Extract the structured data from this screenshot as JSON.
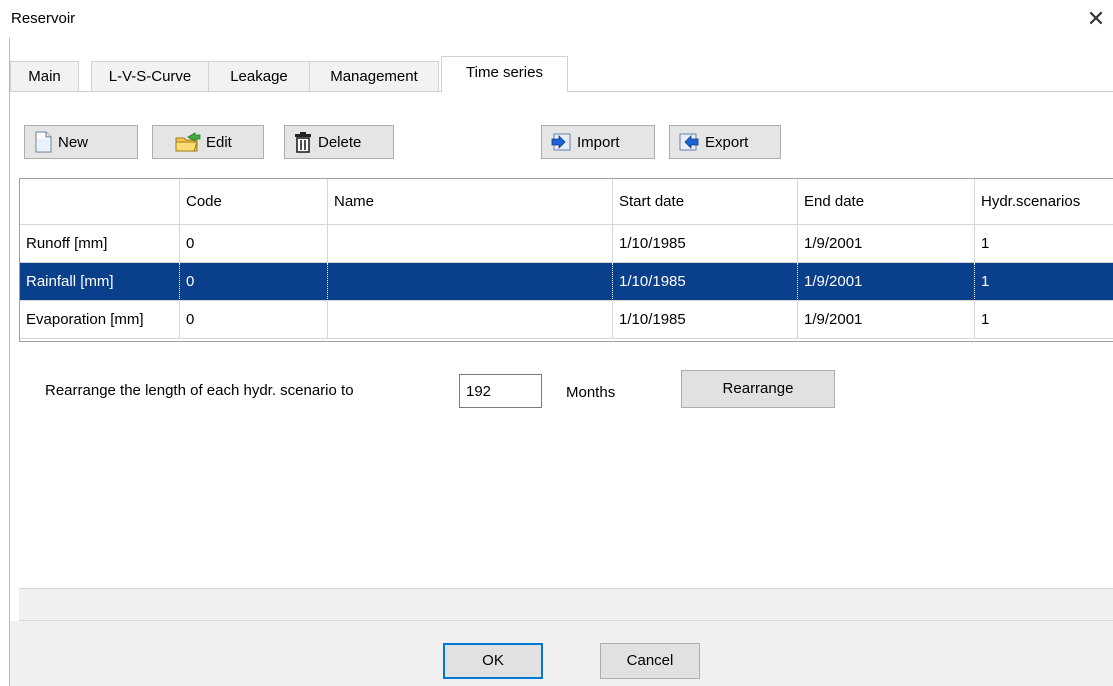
{
  "window": {
    "title": "Reservoir",
    "close_symbol": "✕"
  },
  "tabs": [
    {
      "label": "Main"
    },
    {
      "label": "L-V-S-Curve"
    },
    {
      "label": "Leakage"
    },
    {
      "label": "Management"
    },
    {
      "label": "Time series",
      "active": true
    }
  ],
  "toolbar": {
    "new_label": "New",
    "edit_label": "Edit",
    "delete_label": "Delete",
    "import_label": "Import",
    "export_label": "Export"
  },
  "table": {
    "columns": [
      "",
      "Code",
      "Name",
      "Start date",
      "End date",
      "Hydr.scenarios"
    ],
    "rows": [
      [
        "Runoff [mm]",
        "0",
        "",
        "1/10/1985",
        "1/9/2001",
        "1"
      ],
      [
        "Rainfall [mm]",
        "0",
        "",
        "1/10/1985",
        "1/9/2001",
        "1"
      ],
      [
        "Evaporation [mm]",
        "0",
        "",
        "1/10/1985",
        "1/9/2001",
        "1"
      ]
    ],
    "selected_row_index": 1
  },
  "rearrange": {
    "label": "Rearrange the length of each hydr. scenario to",
    "months_value": "192",
    "months_unit": "Months",
    "button_label": "Rearrange"
  },
  "footer": {
    "ok_label": "OK",
    "cancel_label": "Cancel"
  },
  "colors": {
    "selection": "#0a3f8c",
    "default_button_border": "#0078d7",
    "window_edge": "#e8b36d"
  }
}
